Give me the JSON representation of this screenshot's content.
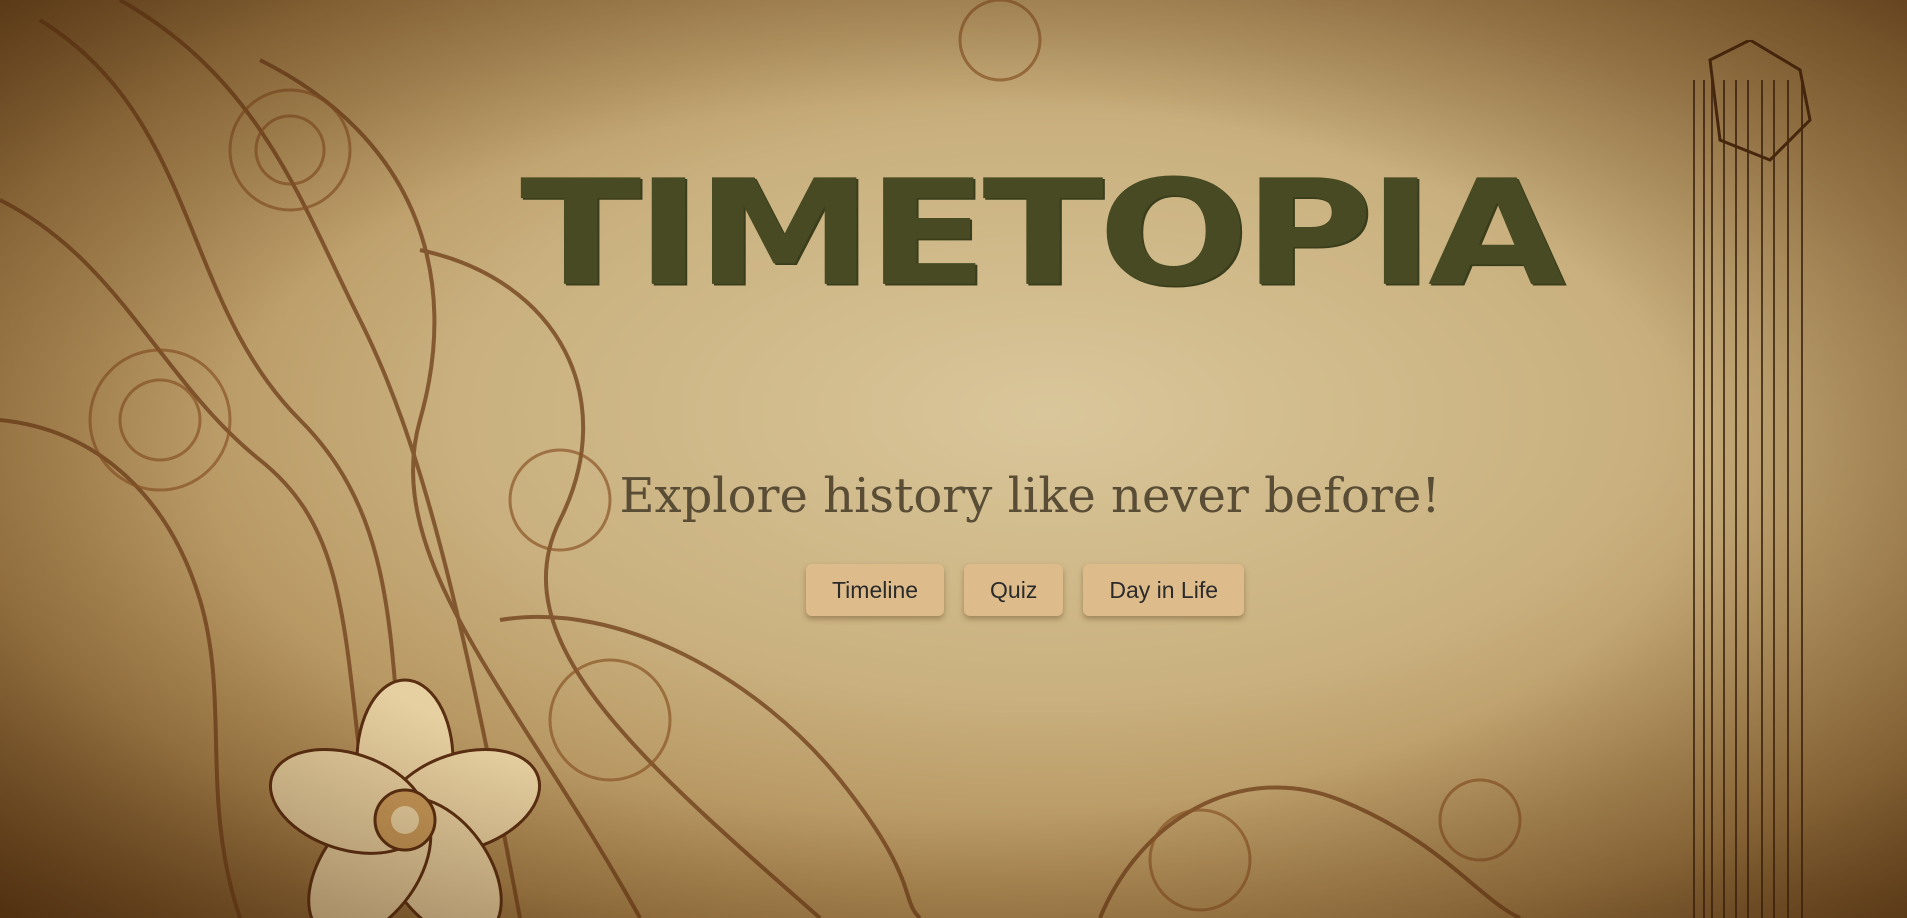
{
  "header": {
    "title": "TIMETOPIA",
    "subtitle": "Explore history like never before!"
  },
  "nav": {
    "buttons": [
      "Timeline",
      "Quiz",
      "Day in Life"
    ]
  },
  "colors": {
    "title": "#474a22",
    "subtitle": "#5a4d36",
    "button_bg": "#ddbb8a",
    "background": "#c9b07e"
  },
  "decor": {
    "left_ornament": "floral-swirl-ornament",
    "right_ornament": "vertical-stripes-ornament"
  }
}
